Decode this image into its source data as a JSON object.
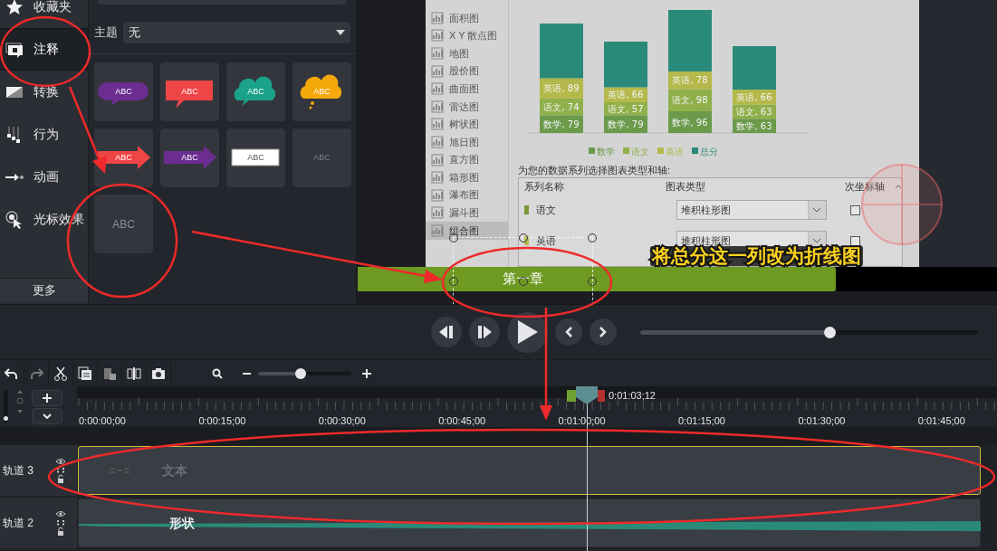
{
  "sidebar": {
    "items": [
      {
        "label": "收藏夹",
        "selected": false
      },
      {
        "label": "注释",
        "selected": true
      },
      {
        "label": "转换",
        "selected": false
      },
      {
        "label": "行为",
        "selected": false
      },
      {
        "label": "动画",
        "selected": false
      },
      {
        "label": "光标效果",
        "selected": false
      }
    ],
    "more_button": "更多"
  },
  "annotations_panel": {
    "theme_label": "主题",
    "theme_value": "无",
    "tiles": [
      {
        "kind": "speech-bubble",
        "color": "#6b2d8f",
        "text": "ABC"
      },
      {
        "kind": "speech-box",
        "color": "#f04545",
        "text": "ABC"
      },
      {
        "kind": "cloud",
        "color": "#1aa38a",
        "text": "ABC"
      },
      {
        "kind": "thought-cloud",
        "color": "#f5a80a",
        "text": "ABC"
      },
      {
        "kind": "arrow",
        "color": "#f04545",
        "text": "ABC"
      },
      {
        "kind": "arrow",
        "color": "#6b2d8f",
        "text": "ABC"
      },
      {
        "kind": "box",
        "color": "#ffffff",
        "text": "ABC"
      },
      {
        "kind": "plain",
        "color": "#7d8188",
        "text": "ABC"
      },
      {
        "kind": "plain-large",
        "color": "#8a8e95",
        "text": "ABC"
      }
    ]
  },
  "preview": {
    "dialog": {
      "chart_types": [
        {
          "label": "面积图",
          "selected": false
        },
        {
          "label": "X Y 散点图",
          "selected": false
        },
        {
          "label": "地图",
          "selected": false
        },
        {
          "label": "股价图",
          "selected": false
        },
        {
          "label": "曲面图",
          "selected": false
        },
        {
          "label": "雷达图",
          "selected": false
        },
        {
          "label": "树状图",
          "selected": false
        },
        {
          "label": "旭日图",
          "selected": false
        },
        {
          "label": "直方图",
          "selected": false
        },
        {
          "label": "箱形图",
          "selected": false
        },
        {
          "label": "瀑布图",
          "selected": false
        },
        {
          "label": "漏斗图",
          "selected": false
        },
        {
          "label": "组合图",
          "selected": true
        }
      ],
      "chart_data": {
        "type": "bar",
        "stacked": true,
        "legend": "bottom",
        "series": [
          {
            "name": "数学",
            "color": "#6a9a4a",
            "values": [
              79,
              79,
              96,
              63
            ],
            "value_labels": [
              "数学, 79",
              "数学, 79",
              "数学, 96",
              "数学, 63"
            ]
          },
          {
            "name": "语文",
            "color": "#8fb04a",
            "values": [
              74,
              57,
              98,
              63
            ],
            "value_labels": [
              "语文, 74",
              "语文, 57",
              "语文, 98",
              "语文, 63"
            ]
          },
          {
            "name": "英语",
            "color": "#b5b84a",
            "values": [
              89,
              66,
              78,
              66
            ],
            "value_labels": [
              "英语, 89",
              "英语, 66",
              "英语, 78",
              "英语, 66"
            ]
          },
          {
            "name": "总分",
            "color": "#2a8a7a",
            "values": [
              242,
              202,
              272,
              192
            ],
            "value_labels": [
              null,
              null,
              null,
              null
            ]
          }
        ]
      },
      "prompt": "为您的数据系列选择图表类型和轴:",
      "series_table": {
        "columns": [
          "系列名称",
          "图表类型",
          "次坐标轴"
        ],
        "rows": [
          {
            "series": "语文",
            "color": "#7a9a3a",
            "chart_type": "堆积柱形图",
            "secondary_axis": false
          },
          {
            "series": "英语",
            "color": "#b9b94a",
            "chart_type": "堆积柱形图",
            "secondary_axis": false
          }
        ]
      }
    },
    "callout": {
      "text": "第一章",
      "selected": true
    },
    "caption": "将总分这一列改为折线图"
  },
  "player": {
    "scrub": {
      "level": 0.56
    }
  },
  "toolbar": {
    "zoom": {
      "level": 0.46
    }
  },
  "timeline": {
    "track_size": {
      "level": 0.05
    },
    "playhead_label": "0:01:03;12",
    "tick_labels": [
      "0:00:00;00",
      "0:00:15;00",
      "0:00:30;00",
      "0:00:45;00",
      "0:01:00;00",
      "0:01:15;00",
      "0:01:30;00",
      "0:01:45;00"
    ],
    "tracks": [
      {
        "name": "轨道 3",
        "clip": {
          "kind": "text",
          "label": "文本",
          "selected": true
        }
      },
      {
        "name": "轨道 2",
        "clip": {
          "kind": "shape",
          "label": "形状",
          "selected": false
        }
      }
    ]
  }
}
